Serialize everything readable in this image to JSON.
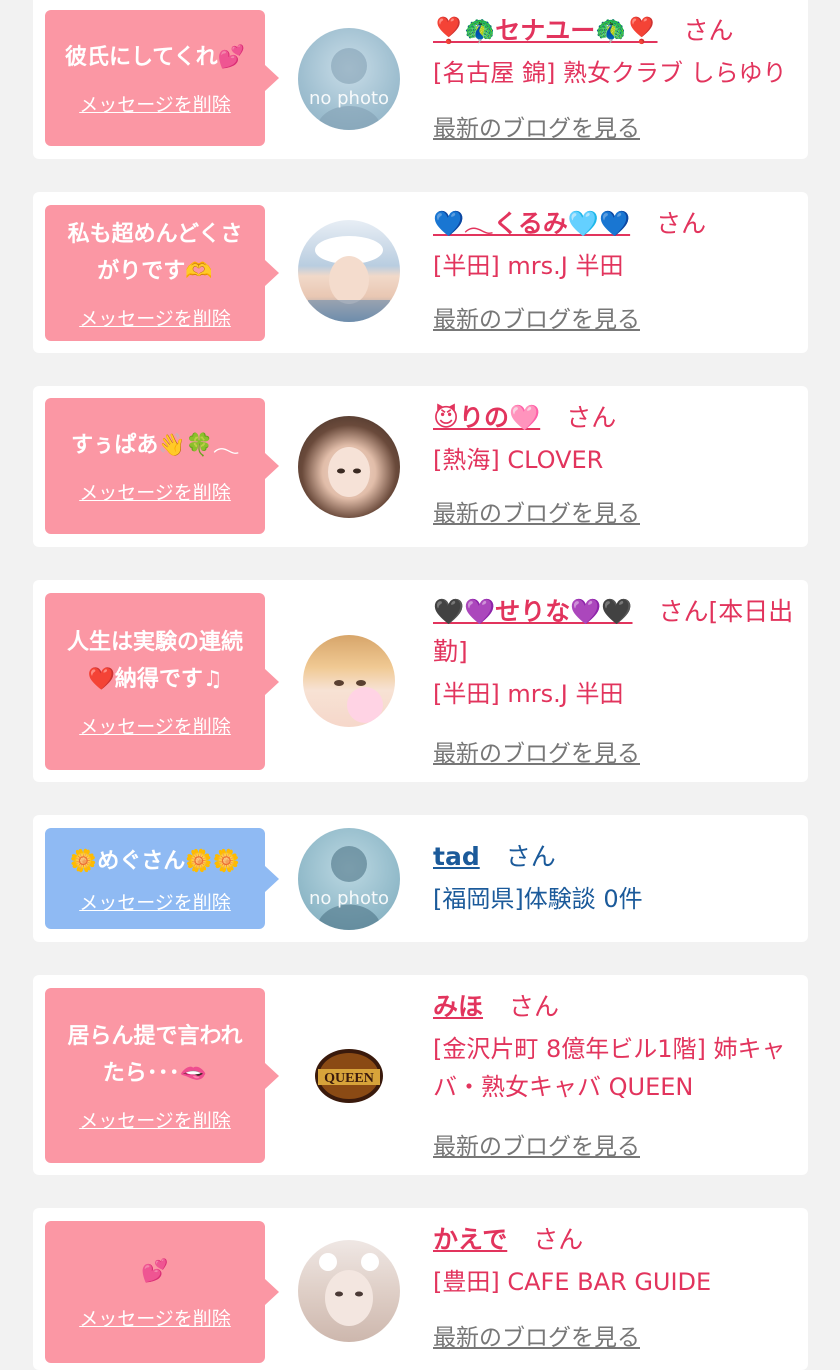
{
  "delete_label": "メッセージを削除",
  "blog_label": "最新のブログを見る",
  "san": "さん",
  "nophoto": "no photo",
  "entries": [
    {
      "message": "彼氏にしてくれ💕",
      "name": "❣️🦚セナユー🦚❣️",
      "status": "",
      "shop": "[名古屋 錦] 熟女クラブ しらゆり"
    },
    {
      "message": "私も超めんどくさがりです🫶",
      "name": "💙𓂃くるみ🩵💙",
      "status": "",
      "shop": "[半田] mrs.J 半田"
    },
    {
      "message": "すぅぱあ👋🍀𓂃",
      "name": "😈りの🩷",
      "status": "",
      "shop": "[熱海] CLOVER"
    },
    {
      "message": "人生は実験の連続❤️納得です♫",
      "name": "🖤💜せりな💜🖤",
      "status": "[本日出勤]",
      "shop": "[半田] mrs.J 半田"
    },
    {
      "message": "🌼めぐさん🌼🌼",
      "name": "tad",
      "status": "",
      "shop": "[福岡県]体験談 0件"
    },
    {
      "message": "居らん提で言われたら･･･🫦",
      "name": "みほ",
      "status": "",
      "shop": "[金沢片町 8億年ビル1階] 姉キャバ・熟女キャバ QUEEN",
      "logo_text": "QUEEN"
    },
    {
      "message": "💕",
      "name": "かえで",
      "status": "",
      "shop": "[豊田] CAFE BAR GUIDE"
    }
  ],
  "colors": {
    "pink_bubble": "#fb97a4",
    "blue_bubble": "#8fbaf3",
    "name_pink": "#e2345d",
    "name_navy": "#1b5a9a",
    "link_gray": "#777777",
    "background": "#f2f2f2"
  }
}
